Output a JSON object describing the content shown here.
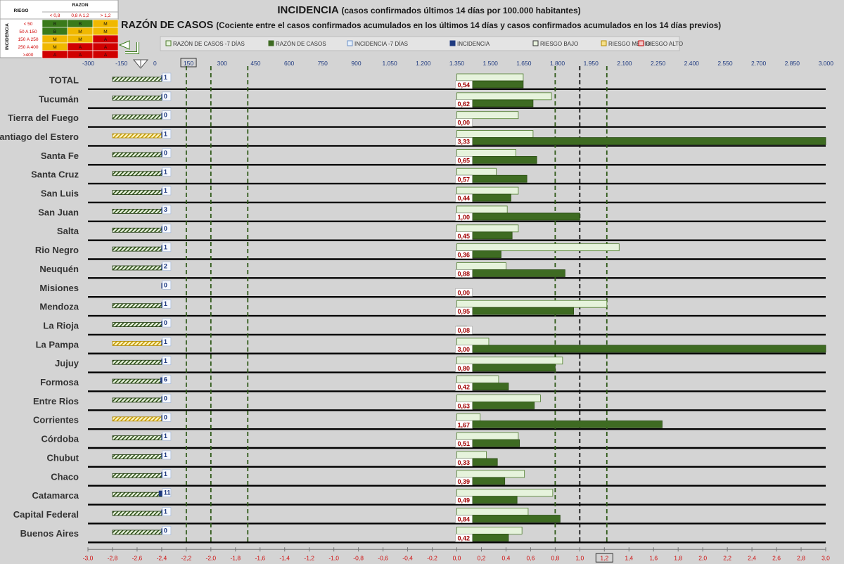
{
  "header": {
    "title": "INCIDENCIA",
    "title_sub": "(casos confirmados últimos 14 días por 100.000 habitantes)",
    "subtitle": "RAZÓN DE CASOS",
    "subtitle_sub": "(Cociente entre el casos confirmados acumulados en los últimos 14 días y casos confirmados acumulados en los 14 días previos)"
  },
  "risk_table": {
    "riesgo_label": "RIEGO",
    "razon_label": "RAZON",
    "incidencia_label": "INCIDENCIA",
    "razon_cols": [
      "< 0,8",
      "0,8 A 1,2",
      "> 1,2"
    ],
    "rows": [
      {
        "range": "< 50",
        "cells": [
          "B",
          "B",
          "M"
        ]
      },
      {
        "range": "50 A 150",
        "cells": [
          "B",
          "M",
          "M"
        ]
      },
      {
        "range": "150 A 250",
        "cells": [
          "M",
          "M",
          "A"
        ]
      },
      {
        "range": "250 A 400",
        "cells": [
          "M",
          "A",
          "A"
        ]
      },
      {
        "range": ">400",
        "cells": [
          "A",
          "A",
          "A"
        ]
      }
    ],
    "colors": {
      "B": "#3a7a1a",
      "M": "#f0b800",
      "A": "#d00000"
    }
  },
  "legend": [
    {
      "label": "RAZÓN DE CASOS -7 DÍAS",
      "color": "#e6f3dc",
      "border": "#4e7d2c"
    },
    {
      "label": "RAZÓN DE CASOS",
      "color": "#3e6b22",
      "border": "#3e6b22"
    },
    {
      "label": "INCIDENCIA -7 DÍAS",
      "color": "#e6f0fb",
      "border": "#6a8fc8"
    },
    {
      "label": "INCIDENCIA",
      "color": "#1f3a80",
      "border": "#1f3a80"
    },
    {
      "label": "RIESGO BAJO",
      "color": "#e8f3de",
      "border": "#333333"
    },
    {
      "label": "RIESGO MEDIO",
      "color": "#f6e08a",
      "border": "#b38a00"
    },
    {
      "label": "RIESGO ALTO",
      "color": "#f6caca",
      "border": "#c00000"
    }
  ],
  "chart_data": {
    "type": "bar",
    "categories": [
      "TOTAL",
      "Tucumán",
      "Tierra del Fuego",
      "Santiago del Estero",
      "Santa Fe",
      "Santa Cruz",
      "San Luis",
      "San Juan",
      "Salta",
      "Rio Negro",
      "Neuquén",
      "Misiones",
      "Mendoza",
      "La Rioja",
      "La Pampa",
      "Jujuy",
      "Formosa",
      "Entre Rios",
      "Corrientes",
      "Córdoba",
      "Chubut",
      "Chaco",
      "Catamarca",
      "Capital Federal",
      "Buenos Aires"
    ],
    "series": [
      {
        "name": "RAZÓN DE CASOS -7 DÍAS",
        "values": [
          0.54,
          0.77,
          0.5,
          0.62,
          0.48,
          0.32,
          0.5,
          0.41,
          0.5,
          1.32,
          0.4,
          0.0,
          1.22,
          0.0,
          0.26,
          0.86,
          0.34,
          0.68,
          0.19,
          0.5,
          0.24,
          0.55,
          0.78,
          0.58,
          0.53
        ]
      },
      {
        "name": "RAZÓN DE CASOS",
        "values": [
          0.54,
          0.62,
          0.0,
          3.33,
          0.65,
          0.57,
          0.44,
          1.0,
          0.45,
          0.36,
          0.88,
          0.0,
          0.95,
          0.08,
          3.0,
          0.8,
          0.42,
          0.63,
          1.67,
          0.51,
          0.33,
          0.39,
          0.49,
          0.84,
          0.42
        ]
      },
      {
        "name": "INCIDENCIA",
        "values": [
          1,
          0,
          0,
          1,
          0,
          1,
          1,
          3,
          0,
          1,
          2,
          0,
          1,
          0,
          1,
          1,
          6,
          0,
          0,
          1,
          1,
          1,
          11,
          1,
          0
        ]
      },
      {
        "name": "RIESGO",
        "values": [
          "B",
          "B",
          "B",
          "M",
          "B",
          "B",
          "B",
          "B",
          "B",
          "B",
          "B",
          "",
          "B",
          "B",
          "M",
          "B",
          "B",
          "B",
          "M",
          "B",
          "B",
          "B",
          "B",
          "B",
          "B"
        ]
      }
    ],
    "value_labels": [
      "0,54",
      "0,62",
      "0,00",
      "3,33",
      "0,65",
      "0,57",
      "0,44",
      "1,00",
      "0,45",
      "0,36",
      "0,88",
      "0,00",
      "0,95",
      "0,08",
      "3,00",
      "0,80",
      "0,42",
      "0,63",
      "1,67",
      "0,51",
      "0,33",
      "0,39",
      "0,49",
      "0,84",
      "0,42"
    ],
    "incidence_labels": [
      "1",
      "0",
      "0",
      "1",
      "0",
      "1",
      "1",
      "3",
      "0",
      "1",
      "2",
      "0",
      "1",
      "0",
      "1",
      "1",
      "6",
      "0",
      "0",
      "1",
      "1",
      "1",
      "11",
      "1",
      "0"
    ],
    "top_axis": {
      "labels": [
        "-300",
        "-150",
        "0",
        "150",
        "300",
        "450",
        "600",
        "750",
        "900",
        "1.050",
        "1.200",
        "1.350",
        "1.500",
        "1.650",
        "1.800",
        "1.950",
        "2.100",
        "2.250",
        "2.400",
        "2.550",
        "2.700",
        "2.850",
        "3.000"
      ],
      "values": [
        -300,
        -150,
        0,
        150,
        300,
        450,
        600,
        750,
        900,
        1050,
        1200,
        1350,
        1500,
        1650,
        1800,
        1950,
        2100,
        2250,
        2400,
        2550,
        2700,
        2850,
        3000
      ],
      "boxed": "150"
    },
    "bottom_axis": {
      "labels": [
        "-3,0",
        "-2,8",
        "-2,6",
        "-2,4",
        "-2,2",
        "-2,0",
        "-1,8",
        "-1,6",
        "-1,4",
        "-1,2",
        "-1,0",
        "-0,8",
        "-0,6",
        "-0,4",
        "-0,2",
        "0,0",
        "0,2",
        "0,4",
        "0,6",
        "0,8",
        "1,0",
        "1,2",
        "1,4",
        "1,6",
        "1,8",
        "2,0",
        "2,2",
        "2,4",
        "2,6",
        "2,8",
        "3,0"
      ],
      "values": [
        -3.0,
        -2.8,
        -2.6,
        -2.4,
        -2.2,
        -2.0,
        -1.8,
        -1.6,
        -1.4,
        -1.2,
        -1.0,
        -0.8,
        -0.6,
        -0.4,
        -0.2,
        0.0,
        0.2,
        0.4,
        0.6,
        0.8,
        1.0,
        1.2,
        1.4,
        1.6,
        1.8,
        2.0,
        2.2,
        2.4,
        2.6,
        2.8,
        3.0
      ],
      "boxed": "1,2"
    },
    "xlim": [
      -3.0,
      3.0
    ],
    "reference_lines": [
      {
        "x": -2.2,
        "color": "#2f5a18"
      },
      {
        "x": -2.0,
        "color": "#2f5a18"
      },
      {
        "x": -1.7,
        "color": "#2f5a18"
      },
      {
        "x": 0.8,
        "color": "#2f5a18"
      },
      {
        "x": 1.0,
        "color": "#111111"
      },
      {
        "x": 1.22,
        "color": "#2f5a18"
      }
    ]
  }
}
